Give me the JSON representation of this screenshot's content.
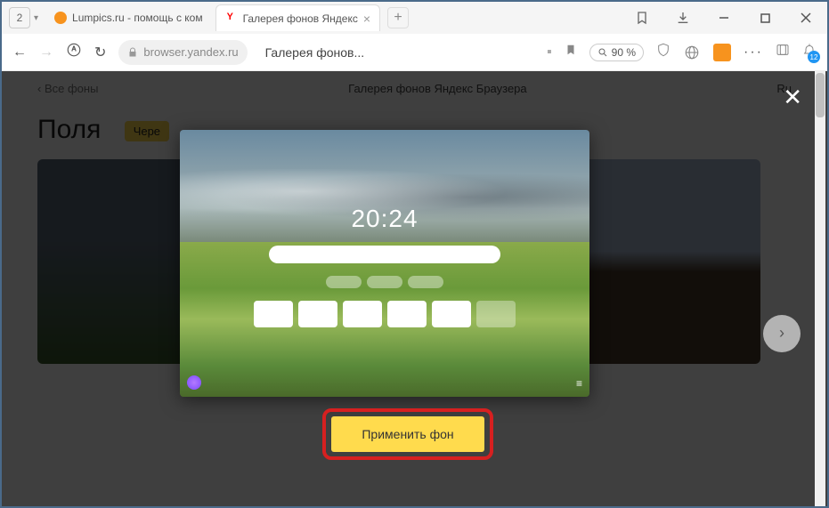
{
  "window": {
    "group_count": "2"
  },
  "tabs": [
    {
      "label": "Lumpics.ru - помощь с ком"
    },
    {
      "label": "Галерея фонов Яндекс"
    }
  ],
  "addr": {
    "url": "browser.yandex.ru",
    "title": "Галерея фонов...",
    "zoom": "90 %",
    "notif": "12"
  },
  "page": {
    "back": "Все фоны",
    "heading": "Галерея фонов Яндекс Браузера",
    "lang": "Ru",
    "section": "Поля",
    "chip": "Чере"
  },
  "modal": {
    "time": "20:24",
    "apply_label": "Применить фон"
  }
}
